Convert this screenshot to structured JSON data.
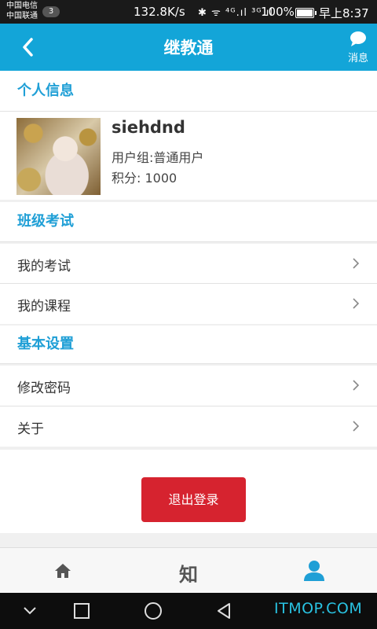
{
  "status_bar": {
    "carrier_1": "中国电信",
    "carrier_2": "中国联通",
    "sim_badge": "3",
    "net_speed": "132.8K/s",
    "signal_text": "✱ ᯤ ⁴ᴳ.ıl ³ᴳ.ıl",
    "battery": "100%",
    "battery_level": 1.0,
    "time": "早上8:37"
  },
  "app_bar": {
    "title": "继教通",
    "messages_label": "消息",
    "back_icon": "chevron-left-icon",
    "messages_icon": "chat-bubble-icon",
    "color": "#13a5d8"
  },
  "profile": {
    "section_title": "个人信息",
    "username": "siehdnd",
    "user_group": "用户组:普通用户",
    "points": "积分: 1000"
  },
  "exam_section": {
    "title": "班级考试",
    "items": [
      {
        "label": "我的考试"
      },
      {
        "label": "我的课程"
      }
    ]
  },
  "settings_section": {
    "title": "基本设置",
    "items": [
      {
        "label": "修改密码"
      },
      {
        "label": "关于"
      }
    ]
  },
  "logout_label": "退出登录",
  "tab_bar": {
    "tabs": [
      {
        "icon": "home-icon",
        "active": false
      },
      {
        "label": "知",
        "active": false
      },
      {
        "icon": "user-icon",
        "active": true
      }
    ],
    "active_color": "#1f9fd6"
  },
  "nav_bar": {
    "buttons": [
      "chevron-down-icon",
      "square-icon",
      "circle-icon",
      "triangle-back-icon"
    ]
  },
  "watermark": "ITMOP.COM",
  "colors": {
    "accent": "#1f9fd6",
    "logout": "#d6232f"
  }
}
